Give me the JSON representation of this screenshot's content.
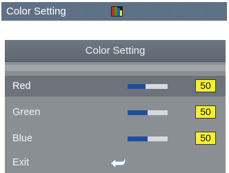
{
  "tab": {
    "title": "Color Setting",
    "icon": "color-bars-icon"
  },
  "menu": {
    "title": "Color Setting",
    "items": [
      {
        "label": "Red",
        "value": "50",
        "level": 0.45,
        "selected": true
      },
      {
        "label": "Green",
        "value": "50",
        "level": 0.5,
        "selected": false
      },
      {
        "label": "Blue",
        "value": "50",
        "level": 0.5,
        "selected": false
      }
    ],
    "exit": {
      "label": "Exit",
      "icon": "return-arrow-icon"
    }
  },
  "colors": {
    "accent_bar": "#1e4f9c",
    "value_box": "#f4f02f",
    "selection": "#6c737b"
  }
}
